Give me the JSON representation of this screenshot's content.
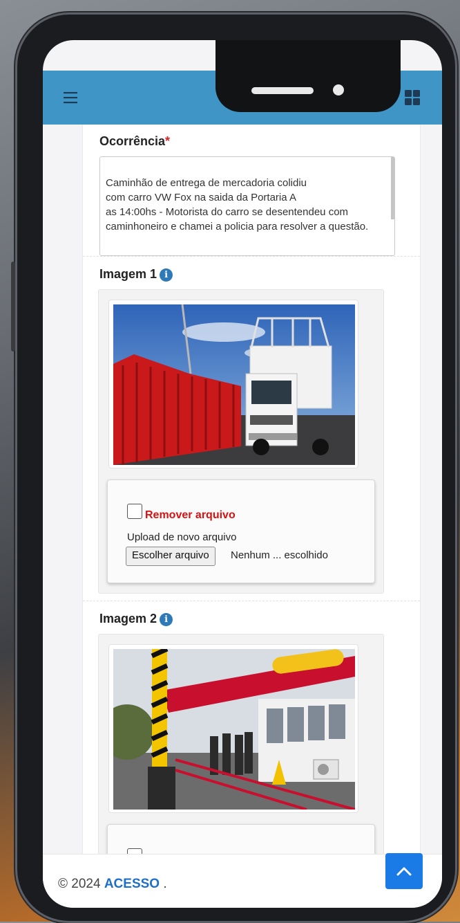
{
  "header": {
    "menu_icon": "hamburger-icon",
    "user_icon": "user-icon",
    "collapse_icon": "collapse-arrows-icon",
    "apps_icon": "grid-icon"
  },
  "form": {
    "occurrence": {
      "label": "Ocorrência",
      "required_mark": "*",
      "value": "Caminhão de entrega de mercadoria colidiu\ncom carro VW Fox na saida da Portaria A\n as 14:00hs - Motorista do carro se desentendeu com caminhoneiro e chamei a policia para resolver a questão."
    },
    "image1": {
      "label": "Imagem 1",
      "remove_label": "Remover arquivo",
      "upload_label": "Upload de novo arquivo",
      "button_label": "Escolher arquivo",
      "file_status": "Nenhum ... escolhido"
    },
    "image2": {
      "label": "Imagem 2"
    }
  },
  "footer": {
    "copyright": "© 2024",
    "brand": "ACESSO",
    "suffix": "."
  },
  "colors": {
    "header_bg": "#3f95c5",
    "accent_red": "#d71111",
    "brand_blue": "#1e6fc9",
    "scroll_top_button": "#1a7be6"
  }
}
